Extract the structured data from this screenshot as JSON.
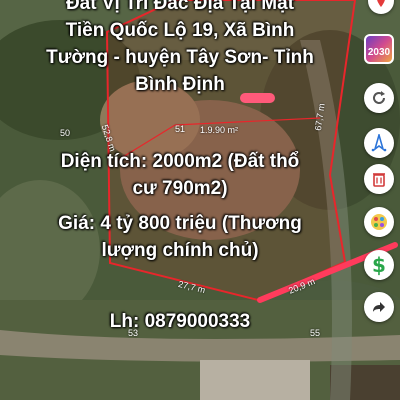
{
  "caption": {
    "title_lines": [
      "Đất Vị Trí Đắc Địa Tại Mặt",
      "Tiền Quốc Lộ 19, Xã Bình",
      "Tường - huyện Tây Sơn- Tỉnh",
      "Bình Định"
    ],
    "area_lines": [
      "Diện tích:  2000m2 (Đất thổ",
      "cư 790m2)"
    ],
    "price_lines": [
      "Giá:  4 tỷ 800 triệu (Thương",
      "lượng chính chủ)"
    ],
    "phone": "Lh: 0879000333"
  },
  "map": {
    "measurements": {
      "left_edge": "52,8 m",
      "right_edge": "67,7 m",
      "bottom_left": "27,7 m",
      "bottom_right": "20,9 m",
      "center": "1.9.90 m²"
    },
    "lot_numbers": {
      "lot_50": "50",
      "lot_51": "51",
      "lot_53": "53",
      "lot_55": "55"
    }
  },
  "toolbar": {
    "year_badge": "2030",
    "buttons": [
      "refresh-icon",
      "compass-icon",
      "trash-icon",
      "palette-icon",
      "dollar-icon",
      "share-icon"
    ]
  },
  "colors": {
    "boundary": "#e8262b",
    "highlight": "#ff3b5c",
    "refresh": "#555555",
    "compass": "#2b74d9",
    "trash": "#d23a3a",
    "dollar": "#29a64a"
  }
}
